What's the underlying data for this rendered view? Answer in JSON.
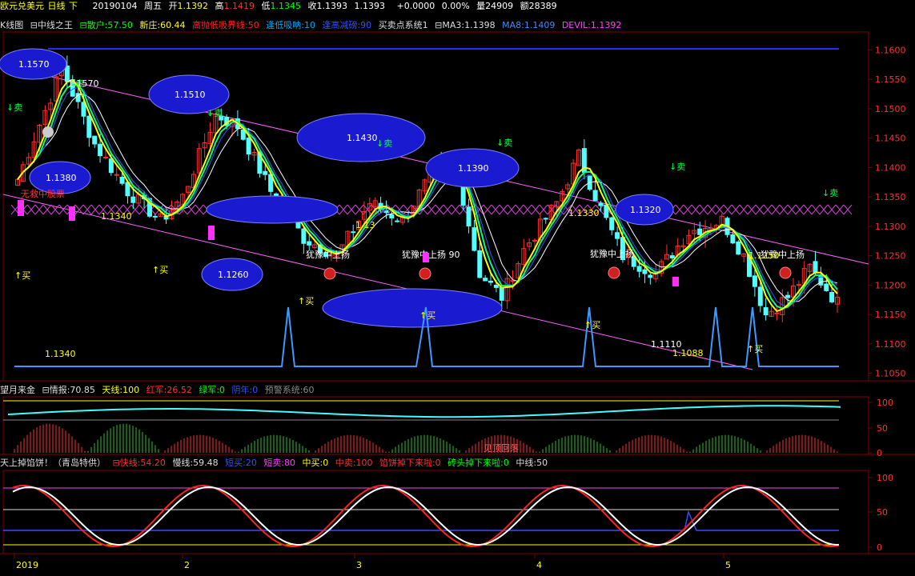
{
  "topbar": {
    "symbol": "欧元兑美元",
    "period": "日线",
    "dir": "下",
    "date": "20190104",
    "weekday": "周五",
    "open_label": "开",
    "open": "1.1392",
    "high_label": "高",
    "high": "1.1419",
    "low_label": "低",
    "low": "1.1345",
    "close_label": "收",
    "close": "1.1393",
    "last": "1.1393",
    "change": "+0.0000",
    "pct": "0.00%",
    "volume": "量24909",
    "amount": "额28389"
  },
  "main_legend": [
    {
      "text": "K线图",
      "color": "#dddddd"
    },
    {
      "text": "⊟中线之王",
      "color": "#dddddd"
    },
    {
      "text": "⊟散户:57.50",
      "color": "#00ff00"
    },
    {
      "text": "新庄:60.44",
      "color": "#ffff00"
    },
    {
      "text": "高抛低吸界线:50",
      "color": "#ff2020"
    },
    {
      "text": "逢低吸呐:10",
      "color": "#00a8ff"
    },
    {
      "text": "逢高减磅:90",
      "color": "#3050ff"
    },
    {
      "text": "买卖点系统1",
      "color": "#dddddd"
    },
    {
      "text": "⊟MA3:1.1398",
      "color": "#dddddd"
    },
    {
      "text": "MA8:1.1409",
      "color": "#3d8cff"
    },
    {
      "text": "DEVIL:1.1392",
      "color": "#ff40ff"
    }
  ],
  "sub1_legend": [
    {
      "text": "望月来金",
      "color": "#dddddd"
    },
    {
      "text": "⊟情报:70.85",
      "color": "#dddddd"
    },
    {
      "text": "天线:100",
      "color": "#ffff00"
    },
    {
      "text": "红军:26.52",
      "color": "#ff3030"
    },
    {
      "text": "绿军:0",
      "color": "#00ff00"
    },
    {
      "text": "阴年:0",
      "color": "#3050ff"
    },
    {
      "text": "预警系统:60",
      "color": "#888888"
    }
  ],
  "sub2_legend": [
    {
      "text": "天上掉馅饼！（青岛特供）",
      "color": "#dddddd"
    },
    {
      "text": "⊟快线:54.20",
      "color": "#ff3030"
    },
    {
      "text": "慢线:59.48",
      "color": "#dddddd"
    },
    {
      "text": "短买:20",
      "color": "#3050ff"
    },
    {
      "text": "短卖:80",
      "color": "#ff40ff"
    },
    {
      "text": "中买:0",
      "color": "#ffff00"
    },
    {
      "text": "中卖:100",
      "color": "#ff3030"
    },
    {
      "text": "馅饼掉下来啦:0",
      "color": "#ff3030"
    },
    {
      "text": "砖头掉下来啦:0",
      "color": "#00ff00"
    },
    {
      "text": "中线:50",
      "color": "#dddddd"
    }
  ],
  "price_axis": [
    "1.1600",
    "1.1550",
    "1.1500",
    "1.1450",
    "1.1400",
    "1.1350",
    "1.1300",
    "1.1250",
    "1.1200",
    "1.1150",
    "1.1100",
    "1.1050"
  ],
  "sub1_axis": [
    "100",
    "50",
    "0"
  ],
  "sub2_axis": [
    "100",
    "50",
    "0"
  ],
  "date_axis": [
    "2019",
    "2",
    "3",
    "4",
    "5"
  ],
  "ellipse_labels": [
    "1.1570",
    "1.1510",
    "1.1430",
    "1.1390",
    "1.1380",
    "1.1320",
    "1.1260"
  ],
  "price_labels": [
    "1.1340",
    "1.1330",
    "1.1110",
    "1.1088",
    "1.1340",
    "1.13",
    "1.1570",
    "1.1250"
  ],
  "signals": {
    "sell": "↓卖",
    "buy": "↑买",
    "hesitate": "犹豫中上扬",
    "hesitate2": "犹豫中上扬 90",
    "wujiu": "无救中股票",
    "jianding": "见顶回落"
  },
  "colors": {
    "bg": "#000000",
    "grid": "#800000",
    "up": "#ff3030",
    "down": "#54ffff",
    "yellow": "#ffff00",
    "white": "#ffffff",
    "green": "#00ff80",
    "blue": "#2060ff",
    "magenta": "#ff40ff",
    "ellipse": "#1a1ad0"
  }
}
